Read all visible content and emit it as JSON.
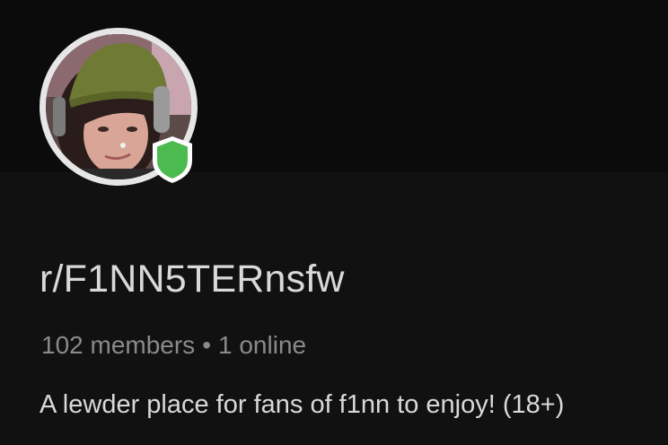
{
  "community": {
    "name": "r/F1NN5TERnsfw",
    "members_label": "102 members",
    "separator": "•",
    "online_label": "1 online",
    "description": "A lewder place for fans of f1nn to enjoy! (18+)"
  },
  "icons": {
    "moderator_badge": "shield-icon"
  },
  "colors": {
    "background": "#111112",
    "banner": "#0b0b0c",
    "avatar_ring": "#e6e6e6",
    "shield": "#4cbb4f",
    "title_text": "#d9d9da",
    "meta_text": "#8a8a8c"
  }
}
